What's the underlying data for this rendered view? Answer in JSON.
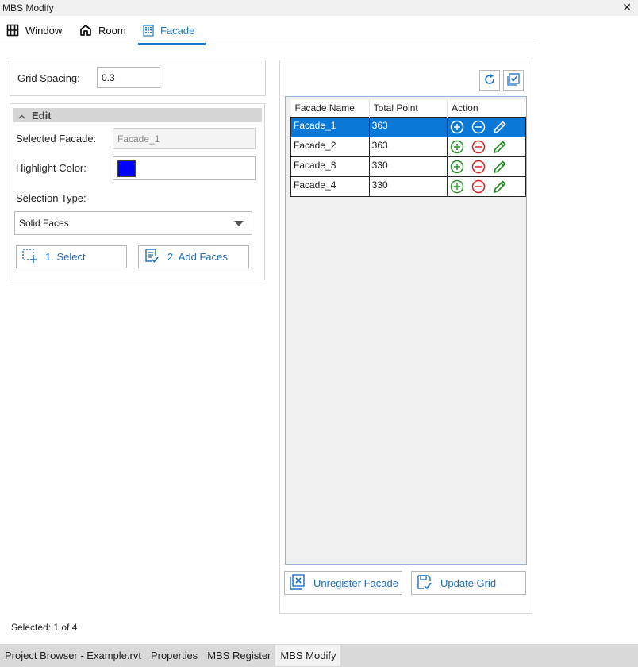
{
  "window": {
    "title": "MBS Modify",
    "close": "✕"
  },
  "tabs": [
    {
      "label": "Window",
      "icon": "window-icon"
    },
    {
      "label": "Room",
      "icon": "house-icon"
    },
    {
      "label": "Facade",
      "icon": "building-icon",
      "active": true
    }
  ],
  "left": {
    "grid_spacing_label": "Grid Spacing:",
    "grid_spacing_value": "0.3",
    "edit_header": "Edit",
    "selected_facade_label": "Selected Facade:",
    "selected_facade_value": "Facade_1",
    "highlight_color_label": "Highlight Color:",
    "highlight_color": "#0000ff",
    "selection_type_label": "Selection Type:",
    "selection_type_value": "Solid Faces",
    "select_button": "1. Select",
    "add_faces_button": "2. Add Faces"
  },
  "right": {
    "columns": [
      "Facade Name",
      "Total Point",
      "Action"
    ],
    "rows": [
      {
        "name": "Facade_1",
        "points": "363",
        "selected": true
      },
      {
        "name": "Facade_2",
        "points": "363"
      },
      {
        "name": "Facade_3",
        "points": "330"
      },
      {
        "name": "Facade_4",
        "points": "330"
      }
    ],
    "unregister_button": "Unregister Facade",
    "update_grid_button": "Update Grid"
  },
  "status": "Selected: 1 of 4",
  "bottom_tabs": [
    {
      "label": "Project Browser - Example.rvt"
    },
    {
      "label": "Properties"
    },
    {
      "label": "MBS Register"
    },
    {
      "label": "MBS Modify",
      "active": true
    }
  ],
  "colors": {
    "accent": "#1e78c8",
    "selected_row": "#0a78d7",
    "add_green": "#2a9a2a",
    "remove_red": "#e02020",
    "edit_green": "#1b8a1b"
  }
}
